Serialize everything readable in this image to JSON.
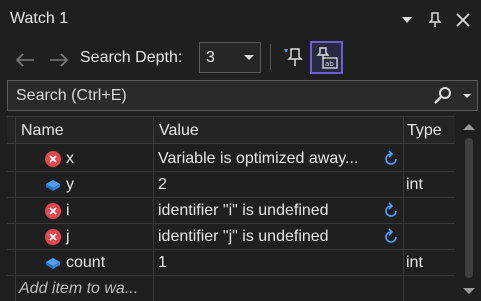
{
  "window": {
    "title": "Watch 1",
    "actions": [
      {
        "name": "dropdown-icon"
      },
      {
        "name": "pin-icon"
      },
      {
        "name": "close-icon"
      }
    ]
  },
  "toolbar": {
    "search_depth_label": "Search Depth:",
    "search_depth_value": "3"
  },
  "search": {
    "placeholder": "Search (Ctrl+E)"
  },
  "grid": {
    "columns": {
      "name": "Name",
      "value": "Value",
      "type": "Type"
    },
    "rows": [
      {
        "name": "x",
        "value": "Variable is optimized away...",
        "type": "",
        "icon": "error-icon",
        "refresh": true
      },
      {
        "name": "y",
        "value": "2",
        "type": "int",
        "icon": "variable-icon",
        "refresh": false
      },
      {
        "name": "i",
        "value": "identifier \"i\" is undefined",
        "type": "",
        "icon": "error-icon",
        "refresh": true
      },
      {
        "name": "j",
        "value": "identifier \"j\" is undefined",
        "type": "",
        "icon": "error-icon",
        "refresh": true
      },
      {
        "name": "count",
        "value": "1",
        "type": "int",
        "icon": "variable-icon",
        "refresh": false
      }
    ],
    "add_item_label": "Add item to wa..."
  },
  "colors": {
    "background": "#1f1f1f",
    "error": "#e5484d",
    "variable": "#4ea0ff",
    "accent": "#6c5fd5"
  }
}
